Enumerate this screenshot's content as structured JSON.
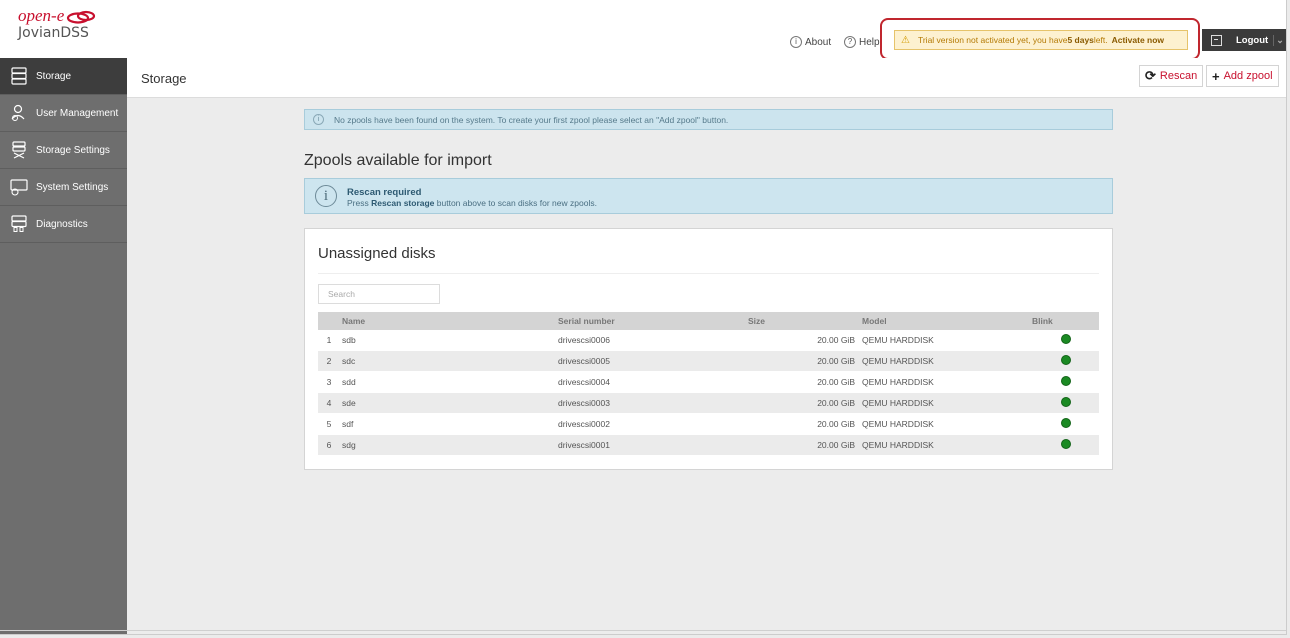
{
  "header": {
    "brand": "open-e",
    "product": "JovianDSS",
    "about_label": "About",
    "help_label": "Help",
    "trial_text": "Trial version not activated yet, you have ",
    "trial_days": "5 days",
    "trial_left": " left.",
    "activate_label": "Activate now",
    "logout_label": "Logout"
  },
  "sidebar": {
    "items": [
      {
        "label": "Storage",
        "icon": "storage-icon",
        "active": true
      },
      {
        "label": "User Management",
        "icon": "user-management-icon"
      },
      {
        "label": "Storage Settings",
        "icon": "storage-settings-icon"
      },
      {
        "label": "System Settings",
        "icon": "system-settings-icon"
      },
      {
        "label": "Diagnostics",
        "icon": "diagnostics-icon"
      }
    ]
  },
  "subheader": {
    "title": "Storage",
    "rescan_label": "Rescan",
    "add_zpool_label": "Add zpool"
  },
  "main": {
    "notice": "No zpools have been found on the system. To create your first zpool please select an \"Add zpool\" button.",
    "import_title": "Zpools available for import",
    "rescan_title": "Rescan required",
    "rescan_text_pre": "Press ",
    "rescan_text_bold": "Rescan storage",
    "rescan_text_post": " button above to scan disks for new zpools."
  },
  "disks": {
    "title": "Unassigned disks",
    "search_placeholder": "Search",
    "columns": {
      "name": "Name",
      "serial": "Serial number",
      "size": "Size",
      "model": "Model",
      "blink": "Blink"
    },
    "rows": [
      {
        "idx": "1",
        "name": "sdb",
        "serial": "drivescsi0006",
        "size": "20.00 GiB",
        "model": "QEMU HARDDISK"
      },
      {
        "idx": "2",
        "name": "sdc",
        "serial": "drivescsi0005",
        "size": "20.00 GiB",
        "model": "QEMU HARDDISK"
      },
      {
        "idx": "3",
        "name": "sdd",
        "serial": "drivescsi0004",
        "size": "20.00 GiB",
        "model": "QEMU HARDDISK"
      },
      {
        "idx": "4",
        "name": "sde",
        "serial": "drivescsi0003",
        "size": "20.00 GiB",
        "model": "QEMU HARDDISK"
      },
      {
        "idx": "5",
        "name": "sdf",
        "serial": "drivescsi0002",
        "size": "20.00 GiB",
        "model": "QEMU HARDDISK"
      },
      {
        "idx": "6",
        "name": "sdg",
        "serial": "drivescsi0001",
        "size": "20.00 GiB",
        "model": "QEMU HARDDISK"
      }
    ]
  },
  "colors": {
    "brand_red": "#c8102e",
    "sidebar_bg": "#6e6e6e",
    "sidebar_active": "#3d3d3d",
    "info_bg": "#cce4ee",
    "warning_bg": "#fdf1d0",
    "blink_green": "#1b8a23"
  }
}
